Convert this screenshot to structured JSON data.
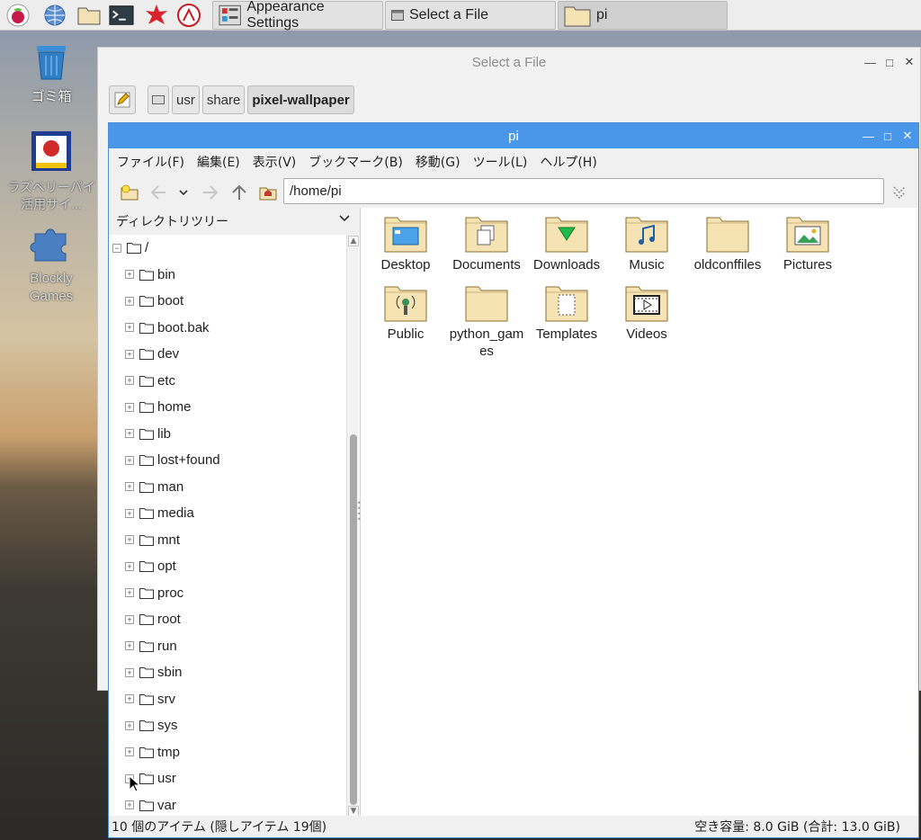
{
  "taskbar": {
    "launchers": [
      "raspberry-menu",
      "web-browser",
      "file-manager",
      "terminal",
      "mathematica",
      "wolfram"
    ],
    "windows": [
      {
        "label": "Appearance Settings"
      },
      {
        "label": "Select a File"
      },
      {
        "label": "pi"
      }
    ]
  },
  "desktop": {
    "icons": [
      {
        "label": "ゴミ箱"
      },
      {
        "label": "ラズベリーパイ活用サイ..."
      },
      {
        "label": "Blockly Games"
      }
    ]
  },
  "select_dialog": {
    "title": "Select a File",
    "path_buttons": [
      "usr",
      "share",
      "pixel-wallpaper"
    ]
  },
  "file_manager": {
    "title": "pi",
    "menu": [
      "ファイル(F)",
      "編集(E)",
      "表示(V)",
      "ブックマーク(B)",
      "移動(G)",
      "ツール(L)",
      "ヘルプ(H)"
    ],
    "address": "/home/pi",
    "side_title": "ディレクトリツリー",
    "tree_root": "/",
    "tree": [
      "bin",
      "boot",
      "boot.bak",
      "dev",
      "etc",
      "home",
      "lib",
      "lost+found",
      "man",
      "media",
      "mnt",
      "opt",
      "proc",
      "root",
      "run",
      "sbin",
      "srv",
      "sys",
      "tmp",
      "usr",
      "var"
    ],
    "files": [
      {
        "name": "Desktop",
        "icon": "desktop-folder"
      },
      {
        "name": "Documents",
        "icon": "documents-folder"
      },
      {
        "name": "Downloads",
        "icon": "downloads-folder"
      },
      {
        "name": "Music",
        "icon": "music-folder"
      },
      {
        "name": "oldconffiles",
        "icon": "folder"
      },
      {
        "name": "Pictures",
        "icon": "pictures-folder"
      },
      {
        "name": "Public",
        "icon": "public-folder"
      },
      {
        "name": "python_games",
        "icon": "folder"
      },
      {
        "name": "Templates",
        "icon": "templates-folder"
      },
      {
        "name": "Videos",
        "icon": "videos-folder"
      }
    ],
    "status_left": "10 個のアイテム (隠しアイテム 19個)",
    "status_right": "空き容量: 8.0 GiB (合計: 13.0 GiB)"
  },
  "colors": {
    "titlebar_active": "#4a97ea",
    "folder_fill": "#f6e3b4",
    "folder_stroke": "#8a6d2d"
  }
}
